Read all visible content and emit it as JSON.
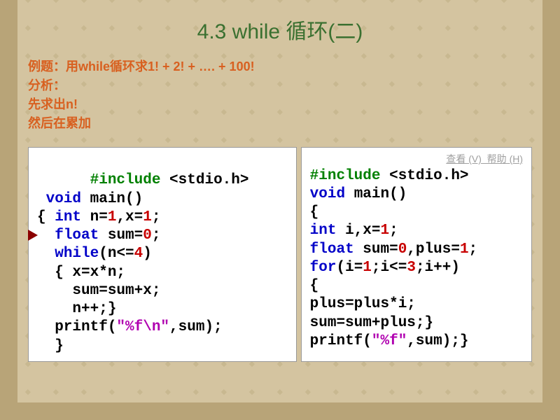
{
  "title": "4.3  while  循环(二)",
  "intro": {
    "line1": "例题：用while循环求1! + 2! + …. + 100!",
    "line2": "分析：",
    "line3": "先求出n!",
    "line4": "然后在累加"
  },
  "menu_trace": "查看 (V)  帮助 (H)",
  "code_left": {
    "l1a": "#include",
    "l1b": " <stdio.h>",
    "l2a": " void",
    "l2b": " main()",
    "l3a": "{ ",
    "l3b": "int",
    "l3c": " n=",
    "l3d": "1",
    "l3e": ",x=",
    "l3f": "1",
    "l3g": ";",
    "l4a": "  ",
    "l4b": "float",
    "l4c": " sum=",
    "l4d": "0",
    "l4e": ";",
    "l5a": "  ",
    "l5b": "while",
    "l5c": "(n<=",
    "l5d": "4",
    "l5e": ")",
    "l6": "  { x=x*n;",
    "l7": "    sum=sum+x;",
    "l8": "    n++;}",
    "l9a": "  printf(",
    "l9b": "\"%f\\n\"",
    "l9c": ",sum);",
    "l10": "  }"
  },
  "code_right": {
    "l1a": "#include",
    "l1b": " <stdio.h>",
    "l2a": "void",
    "l2b": " main()",
    "l3": "{",
    "l4a": "int",
    "l4b": " i,x=",
    "l4c": "1",
    "l4d": ";",
    "l5a": "float",
    "l5b": " sum=",
    "l5c": "0",
    "l5d": ",plus=",
    "l5e": "1",
    "l5f": ";",
    "l6a": "for",
    "l6b": "(i=",
    "l6c": "1",
    "l6d": ";i<=",
    "l6e": "3",
    "l6f": ";i++)",
    "l7": "{",
    "l8": "plus=plus*i;",
    "l9": "sum=sum+plus;}",
    "l10a": "printf(",
    "l10b": "\"%f\"",
    "l10c": ",sum);}"
  }
}
